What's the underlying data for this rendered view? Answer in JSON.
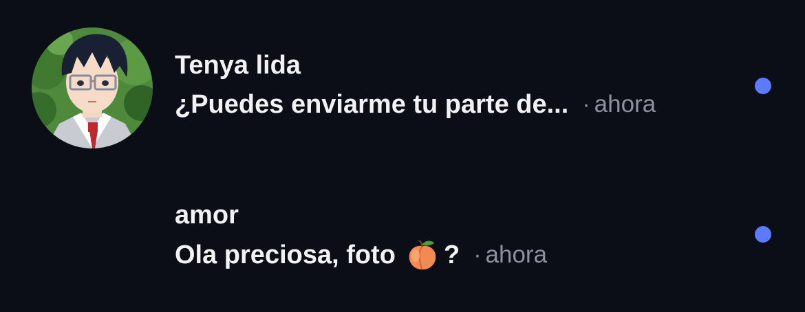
{
  "messages": [
    {
      "sender": "Tenya lida",
      "preview": "¿Puedes enviarme tu parte de...",
      "separator": "·",
      "time": "ahora",
      "unread": true,
      "avatar_icon": "anime-character-avatar"
    },
    {
      "sender": "amor",
      "preview": "Ola preciosa, foto",
      "preview_emoji": "peach-emoji",
      "preview_tail": "?",
      "separator": "·",
      "time": "ahora",
      "unread": true
    }
  ],
  "colors": {
    "background": "#0b0d17",
    "primary_text": "#f2f2f5",
    "secondary_text": "#8f90a0",
    "unread_dot": "#5b7bff"
  }
}
